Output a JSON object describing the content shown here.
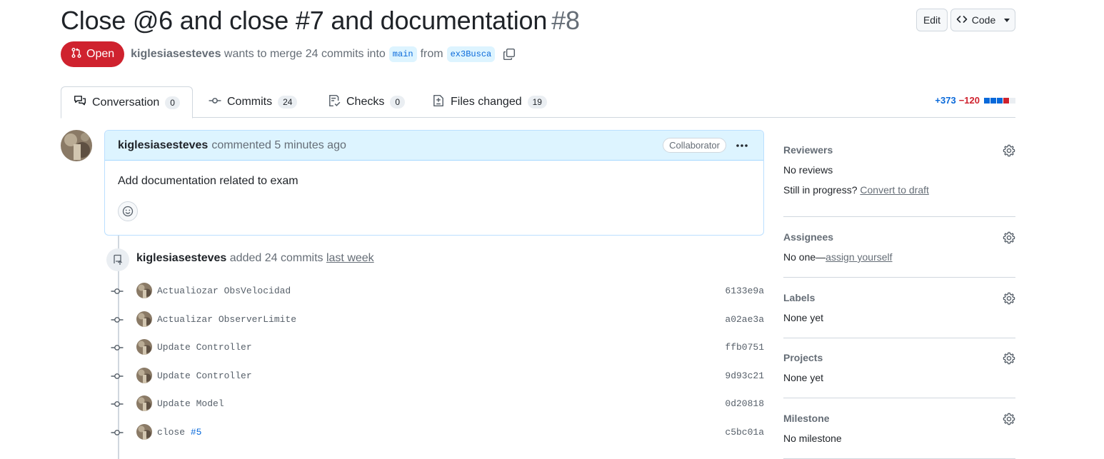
{
  "pr": {
    "title": "Close @6 and close #7 and documentation",
    "number": "#8",
    "state": "Open",
    "author": "kiglesiasesteves",
    "merge_text": "wants to merge 24 commits into",
    "base_branch": "main",
    "from_text": "from",
    "head_branch": "ex3Busca"
  },
  "header_buttons": {
    "edit": "Edit",
    "code": "Code"
  },
  "tabs": [
    {
      "label": "Conversation",
      "count": "0"
    },
    {
      "label": "Commits",
      "count": "24"
    },
    {
      "label": "Checks",
      "count": "0"
    },
    {
      "label": "Files changed",
      "count": "19"
    }
  ],
  "diffstat": {
    "additions": "+373",
    "deletions": "−120",
    "colors": [
      "#0969da",
      "#0969da",
      "#0969da",
      "#cf222e",
      "#eaeef2"
    ]
  },
  "comment": {
    "author": "kiglesiasesteves",
    "action": "commented 5 minutes ago",
    "role": "Collaborator",
    "body": "Add documentation related to exam"
  },
  "push_event": {
    "author": "kiglesiasesteves",
    "text": "added 24 commits",
    "when": "last week"
  },
  "commits": [
    {
      "message": "Actualiozar ObsVelocidad",
      "issue": "",
      "sha": "6133e9a"
    },
    {
      "message": "Actualizar ObserverLimite",
      "issue": "",
      "sha": "a02ae3a"
    },
    {
      "message": "Update Controller",
      "issue": "",
      "sha": "ffb0751"
    },
    {
      "message": "Update Controller",
      "issue": "",
      "sha": "9d93c21"
    },
    {
      "message": "Update Model",
      "issue": "",
      "sha": "0d20818"
    },
    {
      "message": "close ",
      "issue": "#5",
      "sha": "c5bc01a"
    }
  ],
  "sidebar": {
    "reviewers": {
      "title": "Reviewers",
      "value": "No reviews",
      "progress_text": "Still in progress?",
      "progress_link": "Convert to draft"
    },
    "assignees": {
      "title": "Assignees",
      "value": "No one—",
      "link": "assign yourself"
    },
    "labels": {
      "title": "Labels",
      "value": "None yet"
    },
    "projects": {
      "title": "Projects",
      "value": "None yet"
    },
    "milestone": {
      "title": "Milestone",
      "value": "No milestone"
    }
  }
}
